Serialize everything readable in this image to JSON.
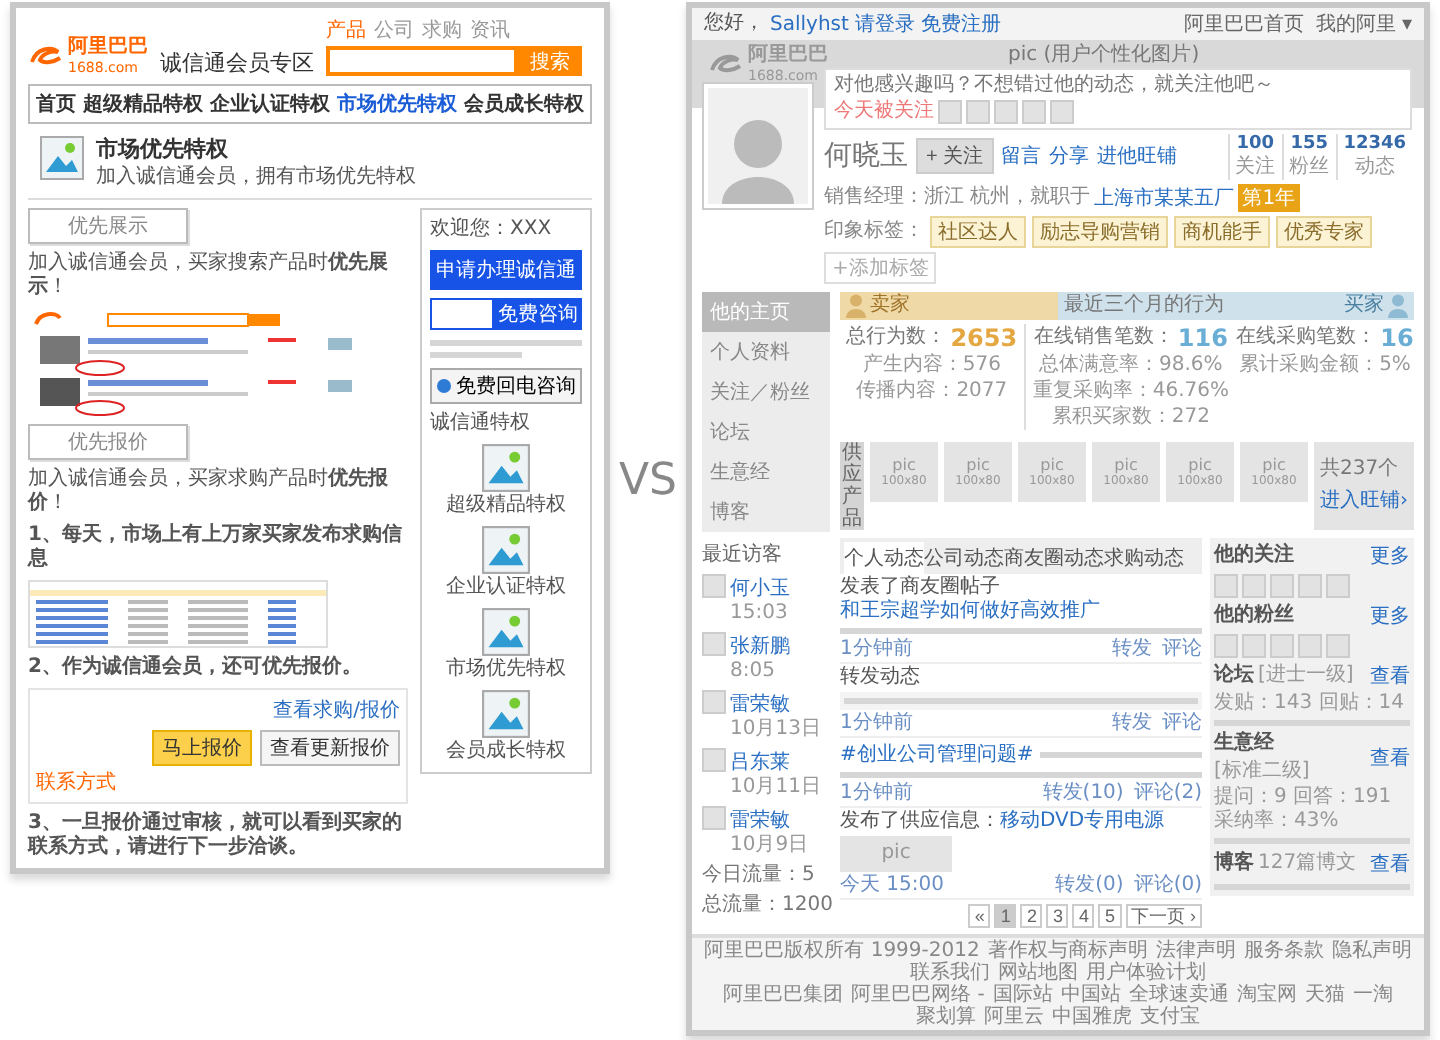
{
  "left_page": {
    "logo": {
      "name": "阿里巴巴",
      "domain": "1688.com"
    },
    "title": "诚信通会员专区",
    "search_tabs": [
      {
        "label": "产品",
        "selected": true
      },
      {
        "label": "公司",
        "selected": false
      },
      {
        "label": "求购",
        "selected": false
      },
      {
        "label": "资讯",
        "selected": false
      }
    ],
    "search_button": "搜索",
    "nav": [
      {
        "label": "首页",
        "selected": false
      },
      {
        "label": "超级精品特权",
        "selected": false
      },
      {
        "label": "企业认证特权",
        "selected": false
      },
      {
        "label": "市场优先特权",
        "selected": true
      },
      {
        "label": "会员成长特权",
        "selected": false
      }
    ],
    "section": {
      "title": "市场优先特权",
      "subtitle": "加入诚信通会员，拥有市场优先特权"
    },
    "showcase": {
      "heading": "优先展示",
      "text": "加入诚信通会员，买家搜索产品时**优先展示**！"
    },
    "quote": {
      "heading": "优先报价",
      "text": "加入诚信通会员，买家求购产品时**优先报价**！",
      "step_1": "1、每天，市场上有上万家买家发布求购信息",
      "step_2": "2、作为诚信通会员，还可优先报价。",
      "link": "查看求购/报价",
      "buttons": [
        {
          "label": "马上报价",
          "kind": "primary"
        },
        {
          "label": "查看更新报价",
          "kind": "plain"
        }
      ],
      "contact": "联系方式",
      "step_3": "3、一旦报价通过审核，就可以看到买家的联系方式，请进行下一步洽谈。"
    },
    "sidebar": {
      "welcome": "欢迎您：XXX",
      "apply_button": "申请办理诚信通",
      "consult_button": "免费咨询",
      "callback_button": "免费回电咨询",
      "privileges_title": "诚信通特权",
      "privileges": [
        "超级精品特权",
        "企业认证特权",
        "市场优先特权",
        "会员成长特权"
      ]
    }
  },
  "versus": "VS",
  "right_page": {
    "top_bar": {
      "greeting": "您好，",
      "user": "Sallyhst",
      "login": "请登录",
      "register": "免费注册",
      "links": [
        "阿里巴巴首页",
        "我的阿里 ▾"
      ]
    },
    "banner": {
      "logo": {
        "name": "阿里巴巴",
        "domain": "1688.com"
      },
      "caption": "pic (用户个性化图片)"
    },
    "bubble": {
      "text": "对他感兴趣吗？不想错过他的动态，就关注他吧～",
      "today": "今天被关注"
    },
    "profile": {
      "name": "何晓玉",
      "follow_button": "+ 关注",
      "actions": [
        "留言",
        "分享",
        "进他旺铺"
      ],
      "location": "销售经理：浙江 杭州，就职于",
      "company": "上海市某某五厂",
      "badge": "第1年",
      "tags_label": "印象标签：",
      "tags": [
        "社区达人",
        "励志导购营销",
        "商机能手",
        "优秀专家"
      ],
      "add_tag": "+添加标签",
      "stats": [
        {
          "value": "100",
          "label": "关注"
        },
        {
          "value": "155",
          "label": "粉丝"
        },
        {
          "value": "12346",
          "label": "动态"
        }
      ]
    },
    "nav": [
      {
        "label": "他的主页",
        "selected": true
      },
      {
        "label": "个人资料",
        "selected": false
      },
      {
        "label": "关注／粉丝",
        "selected": false
      },
      {
        "label": "论坛",
        "selected": false
      },
      {
        "label": "生意经",
        "selected": false
      },
      {
        "label": "博客",
        "selected": false
      }
    ],
    "visitors": {
      "title": "最近访客",
      "items": [
        {
          "name": "何小玉",
          "time": "15:03"
        },
        {
          "name": "张新鹏",
          "time": "8:05"
        },
        {
          "name": "雷荣敏",
          "time": "10月13日"
        },
        {
          "name": "吕东莱",
          "time": "10月11日"
        },
        {
          "name": "雷荣敏",
          "time": "10月9日"
        }
      ],
      "today": "今日流量：5",
      "total": "总流量：1200"
    },
    "behavior": {
      "title": "最近三个月的行为",
      "seller_label": "卖家",
      "buyer_label": "买家",
      "total": {
        "label": "总行为数：",
        "value": "2653"
      },
      "seller_stats": [
        "产生内容：576",
        "传播内容：2077"
      ],
      "sales": {
        "label": "在线销售笔数：",
        "value": "116"
      },
      "sales_stats": [
        "总体满意率：98.6%",
        "重复采购率：46.76%",
        "累积买家数：272"
      ],
      "purchases": {
        "label": "在线采购笔数：",
        "value": "16"
      },
      "purchase_stats": [
        "累计采购金额：5%"
      ]
    },
    "products": {
      "label": "供应产品",
      "items": [
        {
          "title": "pic",
          "size": "100x80"
        },
        {
          "title": "pic",
          "size": "100x80"
        },
        {
          "title": "pic",
          "size": "100x80"
        },
        {
          "title": "pic",
          "size": "100x80"
        },
        {
          "title": "pic",
          "size": "100x80"
        },
        {
          "title": "pic",
          "size": "100x80"
        }
      ],
      "count": "共237个",
      "shop_link": "进入旺铺›"
    },
    "feed_tabs": [
      {
        "label": "个人动态",
        "selected": true
      },
      {
        "label": "公司动态",
        "selected": false
      },
      {
        "label": "商友圈动态",
        "selected": false
      },
      {
        "label": "求购动态",
        "selected": false
      }
    ],
    "feed": [
      {
        "kind": "post",
        "action": "发表了商友圈帖子",
        "link": "和王宗超学如何做好高效推广",
        "time": "1分钟前",
        "actions": [
          "转发",
          "评论"
        ]
      },
      {
        "kind": "repost",
        "action": "转发动态",
        "time": "1分钟前",
        "actions": [
          "转发",
          "评论"
        ]
      },
      {
        "kind": "topic",
        "link": "#创业公司管理问题#",
        "time": "1分钟前",
        "actions": [
          "转发(10)",
          "评论(2)"
        ]
      },
      {
        "kind": "supply",
        "action": "发布了供应信息：",
        "link": "移动DVD专用电源",
        "picture": "pic",
        "time": "今天 15:00",
        "actions": [
          "转发(0)",
          "评论(0)"
        ]
      }
    ],
    "pagination": [
      {
        "label": "«",
        "selected": false
      },
      {
        "label": "1",
        "selected": true
      },
      {
        "label": "2",
        "selected": false
      },
      {
        "label": "3",
        "selected": false
      },
      {
        "label": "4",
        "selected": false
      },
      {
        "label": "5",
        "selected": false
      },
      {
        "label": "下一页 ›",
        "selected": false
      }
    ],
    "side": {
      "following": {
        "title": "他的关注",
        "more": "更多"
      },
      "fans": {
        "title": "他的粉丝",
        "more": "更多"
      },
      "forum": {
        "title": "论坛",
        "rank": "[进士一级]",
        "link": "查看",
        "stats": "发贴：143 回贴：14"
      },
      "business": {
        "title": "生意经",
        "rank": "[标准二级]",
        "link": "查看",
        "stats": "提问：9 回答：191 采纳率：43%"
      },
      "blog": {
        "title": "博客",
        "rank": "127篇博文",
        "link": "查看"
      }
    },
    "footer": [
      [
        "阿里巴巴版权所有 1999-2012",
        "著作权与商标声明",
        "法律声明",
        "服务条款",
        "隐私声明",
        "联系我们",
        "网站地图",
        "用户体验计划"
      ],
      [
        "阿里巴巴集团",
        "阿里巴巴网络 -",
        "国际站",
        "中国站",
        "全球速卖通",
        "淘宝网",
        "天猫",
        "一淘",
        "聚划算",
        "阿里云",
        "中国雅虎",
        "支付宝"
      ]
    ]
  }
}
